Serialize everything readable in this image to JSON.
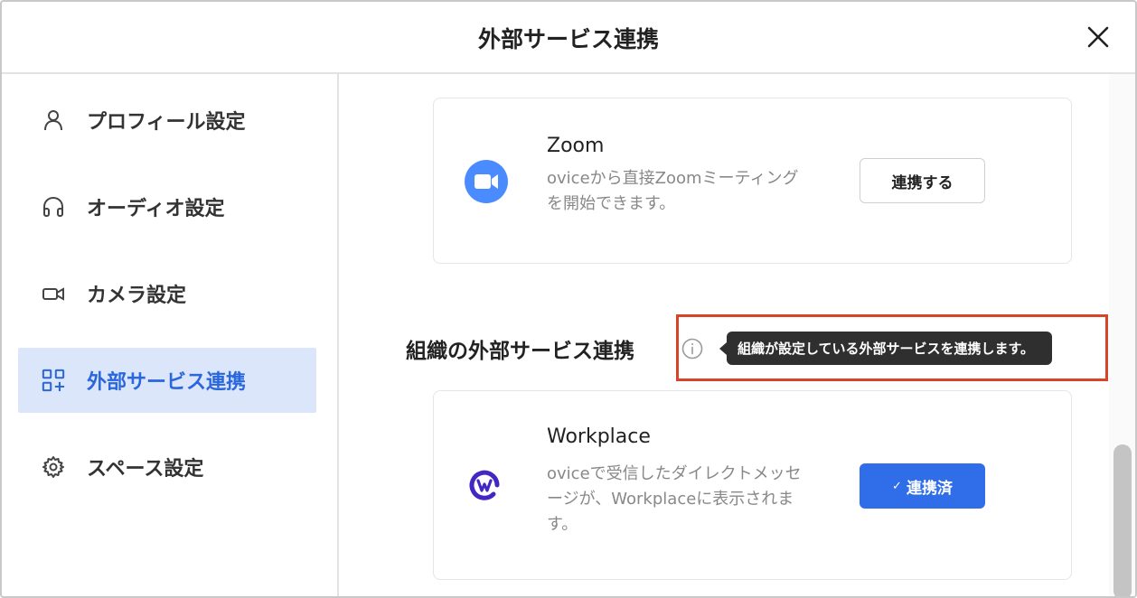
{
  "dialog": {
    "title": "外部サービス連携"
  },
  "sidebar": {
    "items": [
      {
        "label": "プロフィール設定",
        "icon": "user-icon",
        "active": false
      },
      {
        "label": "オーディオ設定",
        "icon": "headphones-icon",
        "active": false
      },
      {
        "label": "カメラ設定",
        "icon": "camera-icon",
        "active": false
      },
      {
        "label": "外部サービス連携",
        "icon": "apps-add-icon",
        "active": true
      },
      {
        "label": "スペース設定",
        "icon": "gear-icon",
        "active": false
      }
    ]
  },
  "main": {
    "zoom": {
      "title": "Zoom",
      "desc_line1": "oviceから直接Zoomミーティング",
      "desc_line2": "を開始できます。",
      "button": "連携する",
      "icon": "zoom-icon"
    },
    "org_section": {
      "title": "組織の外部サービス連携",
      "tooltip": "組織が設定している外部サービスを連携します。"
    },
    "workplace": {
      "title": "Workplace",
      "desc_line1": "oviceで受信したダイレクトメッセ",
      "desc_line2": "ージが、Workplaceに表示されま",
      "desc_line3": "す。",
      "button_check": "✓",
      "button": "連携済",
      "icon": "workplace-icon"
    }
  },
  "colors": {
    "accent": "#2f6ee8",
    "active_bg": "#dbe6fb",
    "active_text": "#2a66dc",
    "zoom": "#4a8cff",
    "workplace": "#4326c4",
    "highlight": "#d9432a"
  }
}
